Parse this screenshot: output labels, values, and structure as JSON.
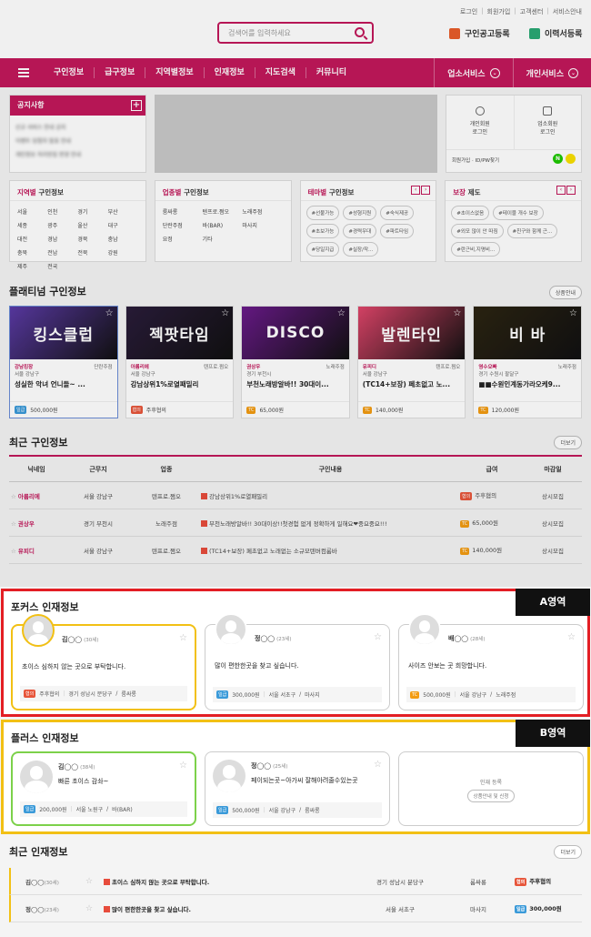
{
  "top_links": [
    "로그인",
    "회원가입",
    "고객센터",
    "서비스안내"
  ],
  "search": {
    "placeholder": "검색어를 입력하세요"
  },
  "top_buttons": {
    "job_post": "구인공고등록",
    "resume": "이력서등록"
  },
  "nav": {
    "items": [
      "구인정보",
      "급구정보",
      "지역별정보",
      "인재정보",
      "지도검색",
      "커뮤니티"
    ],
    "right": [
      "업소서비스",
      "개인서비스"
    ]
  },
  "notice": {
    "title": "공지사항",
    "items": [
      "신규 서비스 안내 공지",
      "이벤트 당첨자 발표 안내",
      "개인정보 처리방침 변경 안내"
    ]
  },
  "login": {
    "personal": "개인회원\n로그인",
    "business": "업소회원\n로그인",
    "bottom": "회원가입 · ID/PW찾기",
    "naver": "N"
  },
  "categories": [
    {
      "prefix": "지역별",
      "suffix": " 구인정보",
      "items": [
        "서울",
        "인천",
        "경기",
        "부산",
        "세종",
        "광주",
        "울산",
        "대구",
        "대전",
        "경남",
        "경북",
        "충남",
        "충북",
        "전남",
        "전북",
        "강원",
        "제주",
        "전국"
      ]
    },
    {
      "prefix": "업종별",
      "suffix": " 구인정보",
      "items": [
        "룸싸롱",
        "텐프로.쩜오",
        "노래주점",
        "단란주점",
        "바(BAR)",
        "마사지",
        "요정",
        "기타"
      ]
    },
    {
      "prefix": "테마별",
      "suffix": " 구인정보",
      "tags": [
        "#선불가능",
        "#성형지원",
        "#숙식제공",
        "#초보가능",
        "#경력우대",
        "#파트타임",
        "#당일지급",
        "#실장/작..."
      ]
    },
    {
      "prefix": "보장",
      "suffix": " 제도",
      "tags": [
        "#초이스없음",
        "#테이블 개수 보장",
        "#외모 많이 안 따짐",
        "#친구와 함께 근...",
        "#란근비,지명비..."
      ]
    }
  ],
  "platinum": {
    "title": "플래티넘 구인정보",
    "more": "상품안내",
    "cards": [
      {
        "img_text": "킹스클럽",
        "bg": "#5b3aa6",
        "name": "강남킹장",
        "type": "단란주점",
        "region": "서울 강남구",
        "title": "성실한 악녀 언니들~ ...",
        "pay_badge": "일급",
        "pay": "500,000원",
        "badge_color": "blue"
      },
      {
        "img_text": "젝팟타임",
        "bg": "#2a1c3a",
        "name": "아름리에",
        "type": "텐프로.쩜오",
        "region": "서울 강남구",
        "title": "강남상위1%로열패밀리",
        "pay_badge": "협의",
        "pay": "주후협의",
        "badge_color": "red"
      },
      {
        "img_text": "DISCO",
        "bg": "#6a1a8a",
        "name": "권상우",
        "type": "노래주점",
        "region": "경기 부천시",
        "title": "부천노래방알바!! 30대이...",
        "pay_badge": "TC",
        "pay": "65,000원",
        "badge_color": "orange"
      },
      {
        "img_text": "발렌타인",
        "bg": "#e0456a",
        "name": "유피디",
        "type": "텐프로.쩜오",
        "region": "서울 강남구",
        "title": "(TC14+보장) 페초없고 노...",
        "pay_badge": "TC",
        "pay": "140,000원",
        "badge_color": "orange"
      },
      {
        "img_text": "비 바",
        "bg": "#2c2412",
        "name": "영수오빠",
        "type": "노래주점",
        "region": "경기 수원시 팔달구",
        "title": "■■수원인계동가라오케9...",
        "pay_badge": "TC",
        "pay": "120,000원",
        "badge_color": "orange"
      }
    ]
  },
  "recent_jobs": {
    "title": "최근 구인정보",
    "more": "더보기",
    "headers": [
      "닉네임",
      "근무지",
      "업종",
      "구인내용",
      "급여",
      "마감일"
    ],
    "rows": [
      {
        "nick": "아름리에",
        "region": "서울 강남구",
        "type": "텐프로.쩜오",
        "content": "강남상위1%로열패밀리",
        "pay_badge": "협의",
        "pay": "주후협의",
        "deadline": "상시모집",
        "badge_color": "red"
      },
      {
        "nick": "권상우",
        "region": "경기 부천시",
        "type": "노래주점",
        "content": "부천노래방알바!! 30대이상!!첫경험 없게 정확하게 일해요❤중요중요!!!",
        "pay_badge": "TC",
        "pay": "65,000원",
        "deadline": "상시모집",
        "badge_color": "orange"
      },
      {
        "nick": "유피디",
        "region": "서울 강남구",
        "type": "텐프로.쩜오",
        "content": "(TC14+보장) 페초없고 노래없는 소규모텐버컴룸바",
        "pay_badge": "TC",
        "pay": "140,000원",
        "deadline": "상시모집",
        "badge_color": "orange"
      }
    ]
  },
  "focus": {
    "title": "포커스 인재정보",
    "label": "A영역",
    "cards": [
      {
        "name": "김◯◯",
        "age": "(30세)",
        "msg": "초이스 심하지 않는 곳으로 부탁합니다.",
        "pay_badge": "협의",
        "pay": "주후협의",
        "region": "경기 성남시 분당구",
        "type": "룸싸롱",
        "badge_color": "red"
      },
      {
        "name": "정◯◯",
        "age": "(23세)",
        "msg": "많이 편한한곳을 찾고 싶습니다.",
        "pay_badge": "일급",
        "pay": "300,000원",
        "region": "서울 서초구",
        "type": "마사지",
        "badge_color": "blue"
      },
      {
        "name": "배◯◯",
        "age": "(28세)",
        "msg": "사이즈 안보는 곳 희망합니다.",
        "pay_badge": "TC",
        "pay": "500,000원",
        "region": "서울 강남구",
        "type": "노래주점",
        "badge_color": "orange"
      }
    ]
  },
  "plus": {
    "title": "플러스 인재정보",
    "label": "B영역",
    "cards": [
      {
        "name": "김◯◯",
        "age": "(38세)",
        "msg": "빠른 초이스 감솨~",
        "pay_badge": "일급",
        "pay": "200,000원",
        "region": "서울 노원구",
        "type": "바(BAR)",
        "badge_color": "blue"
      },
      {
        "name": "정◯◯",
        "age": "(25세)",
        "msg": "페이되는곳~아가씨 잘해아려줄수있는곳",
        "pay_badge": "일급",
        "pay": "500,000원",
        "region": "서울 강남구",
        "type": "룸싸롱",
        "badge_color": "blue"
      }
    ],
    "empty": {
      "text": "인재 등록",
      "button": "상품안내 및 신청"
    }
  },
  "recent_talent": {
    "title": "최근 인재정보",
    "more": "더보기",
    "rows": [
      {
        "name": "김◯◯",
        "age": "(30세)",
        "msg": "초이스 심하지 않는 곳으로 부탁합니다.",
        "region": "경기 성남시 분당구",
        "type": "룸싸롱",
        "pay_badge": "협의",
        "pay": "주후협의",
        "badge_color": "red"
      },
      {
        "name": "정◯◯",
        "age": "(23세)",
        "msg": "많이 편한한곳을 찾고 싶습니다.",
        "region": "서울 서초구",
        "type": "마사지",
        "pay_badge": "일급",
        "pay": "300,000원",
        "badge_color": "blue"
      }
    ]
  }
}
